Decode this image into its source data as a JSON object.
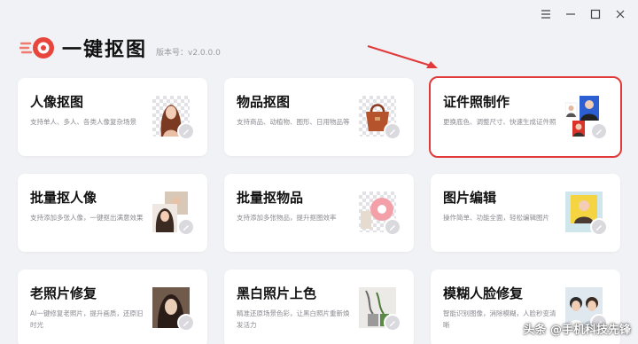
{
  "window": {
    "controls": [
      {
        "name": "menu-icon"
      },
      {
        "name": "minimize-icon"
      },
      {
        "name": "maximize-icon"
      },
      {
        "name": "close-icon"
      }
    ]
  },
  "header": {
    "app_name": "一键抠图",
    "version": "版本号：v2.0.0.0",
    "accent_color": "#e8453c"
  },
  "cards": [
    {
      "title": "人像抠图",
      "desc": "支持单人、多人、各类人像复杂场景",
      "icon": "portrait-thumbnail",
      "highlight": false
    },
    {
      "title": "物品抠图",
      "desc": "支持商品、动植物、图形、日用物品等",
      "icon": "handbag-thumbnail",
      "highlight": false
    },
    {
      "title": "证件照制作",
      "desc": "更换底色、调整尺寸、快速生成证件照",
      "icon": "id-photo-thumbnail",
      "highlight": true
    },
    {
      "title": "批量抠人像",
      "desc": "支持添加多张人像，一键抠出满意效果",
      "icon": "batch-portrait-thumbnail",
      "highlight": false
    },
    {
      "title": "批量抠物品",
      "desc": "支持添加多张物品，提升抠图效率",
      "icon": "batch-item-thumbnail",
      "highlight": false
    },
    {
      "title": "图片编辑",
      "desc": "操作简单、功能全面，轻松编辑图片",
      "icon": "image-edit-thumbnail",
      "highlight": false
    },
    {
      "title": "老照片修复",
      "desc": "AI一键修复老照片，提升画质，还原旧时光",
      "icon": "old-photo-thumbnail",
      "highlight": false
    },
    {
      "title": "黑白照片上色",
      "desc": "精准还原场景色彩，让黑白照片重新焕发活力",
      "icon": "colorize-thumbnail",
      "highlight": false
    },
    {
      "title": "模糊人脸修复",
      "desc": "智能识别图像，消除模糊，人脸秒变清晰",
      "icon": "face-restore-thumbnail",
      "highlight": false
    }
  ],
  "watermark": "头条 @手机科技先锋"
}
